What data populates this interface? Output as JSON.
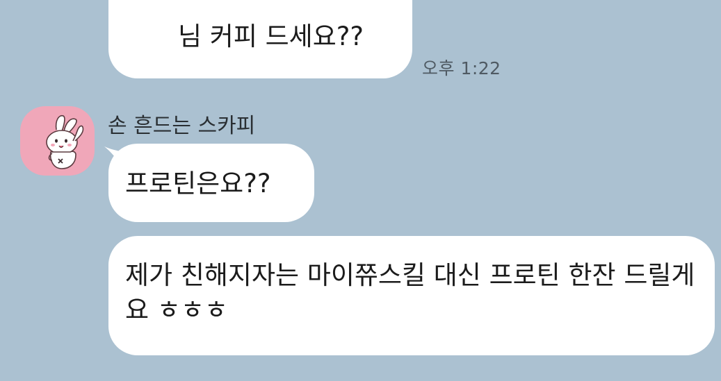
{
  "chat": {
    "outgoing": {
      "text": "님 커피 드세요??",
      "time": "오후 1:22"
    },
    "incoming": {
      "sender": "손 흔드는 스카피",
      "messages": [
        {
          "text": "프로틴은요??"
        },
        {
          "text": "제가 친해지자는 마이쮸스킬 대신 프로틴 한잔 드릴게요 ㅎㅎㅎ"
        }
      ]
    }
  },
  "colors": {
    "background": "#abc1d1",
    "bubble": "#ffffff",
    "avatar_bg": "#f0a7b9"
  },
  "icons": {
    "avatar": "scarpy-rabbit-avatar-icon"
  }
}
